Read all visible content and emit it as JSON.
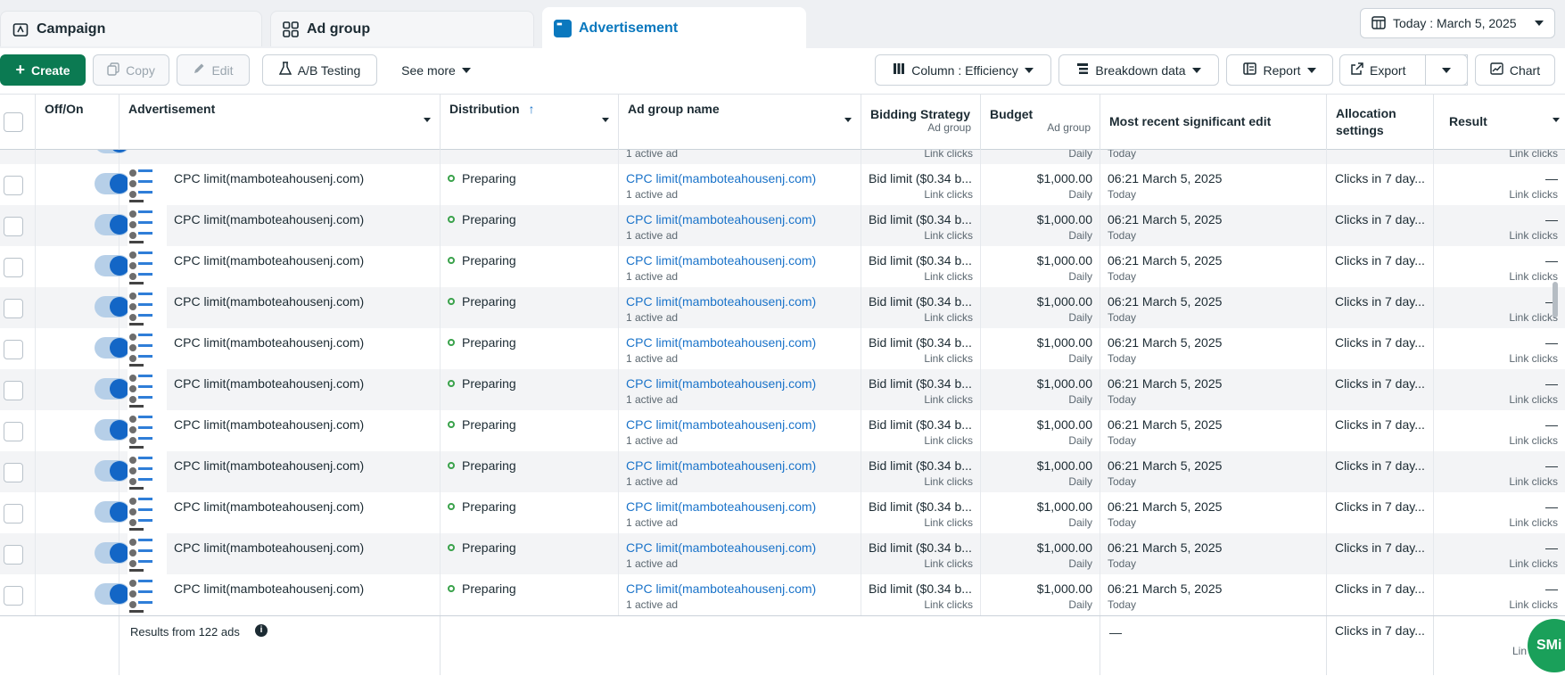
{
  "tabs": [
    {
      "label": "Campaign",
      "icon": "campaign-icon"
    },
    {
      "label": "Ad group",
      "icon": "grid-icon"
    },
    {
      "label": "Advertisement",
      "icon": "ad-icon"
    }
  ],
  "date_filter": {
    "label": "Today : March 5, 2025",
    "icon": "calendar-icon"
  },
  "toolbar": {
    "create": "Create",
    "copy": "Copy",
    "edit": "Edit",
    "ab_testing": "A/B Testing",
    "see_more": "See more",
    "column": "Column : Efficiency",
    "breakdown": "Breakdown data",
    "report": "Report",
    "export": "Export",
    "chart": "Chart"
  },
  "columns": {
    "offon": "Off/On",
    "advertisement": "Advertisement",
    "distribution": "Distribution",
    "ad_group_name": "Ad group name",
    "bidding_strategy": "Bidding Strategy",
    "bidding_strategy_sub": "Ad group",
    "budget": "Budget",
    "budget_sub": "Ad group",
    "recent_edit": "Most recent significant edit",
    "allocation": "Allocation settings",
    "result": "Result"
  },
  "partial_row": {
    "group_sub": "1 active ad",
    "bid_sub": "Link clicks",
    "budget_sub": "Daily",
    "edit_sub": "Today",
    "result_sub": "Link clicks"
  },
  "rows": [
    {
      "name": "CPC limit(mamboteahousenj.com)",
      "status": "Preparing",
      "group": "CPC limit(mamboteahousenj.com)",
      "group_sub": "1 active ad",
      "bid": "Bid limit ($0.34 b...",
      "bid_sub": "Link clicks",
      "budget": "$1,000.00",
      "budget_sub": "Daily",
      "edit": "06:21 March 5, 2025",
      "edit_sub": "Today",
      "allocation": "Clicks in 7 day...",
      "result": "—",
      "result_sub": "Link clicks"
    },
    {
      "name": "CPC limit(mamboteahousenj.com)",
      "status": "Preparing",
      "group": "CPC limit(mamboteahousenj.com)",
      "group_sub": "1 active ad",
      "bid": "Bid limit ($0.34 b...",
      "bid_sub": "Link clicks",
      "budget": "$1,000.00",
      "budget_sub": "Daily",
      "edit": "06:21 March 5, 2025",
      "edit_sub": "Today",
      "allocation": "Clicks in 7 day...",
      "result": "—",
      "result_sub": "Link clicks"
    },
    {
      "name": "CPC limit(mamboteahousenj.com)",
      "status": "Preparing",
      "group": "CPC limit(mamboteahousenj.com)",
      "group_sub": "1 active ad",
      "bid": "Bid limit ($0.34 b...",
      "bid_sub": "Link clicks",
      "budget": "$1,000.00",
      "budget_sub": "Daily",
      "edit": "06:21 March 5, 2025",
      "edit_sub": "Today",
      "allocation": "Clicks in 7 day...",
      "result": "—",
      "result_sub": "Link clicks"
    },
    {
      "name": "CPC limit(mamboteahousenj.com)",
      "status": "Preparing",
      "group": "CPC limit(mamboteahousenj.com)",
      "group_sub": "1 active ad",
      "bid": "Bid limit ($0.34 b...",
      "bid_sub": "Link clicks",
      "budget": "$1,000.00",
      "budget_sub": "Daily",
      "edit": "06:21 March 5, 2025",
      "edit_sub": "Today",
      "allocation": "Clicks in 7 day...",
      "result": "—",
      "result_sub": "Link clicks"
    },
    {
      "name": "CPC limit(mamboteahousenj.com)",
      "status": "Preparing",
      "group": "CPC limit(mamboteahousenj.com)",
      "group_sub": "1 active ad",
      "bid": "Bid limit ($0.34 b...",
      "bid_sub": "Link clicks",
      "budget": "$1,000.00",
      "budget_sub": "Daily",
      "edit": "06:21 March 5, 2025",
      "edit_sub": "Today",
      "allocation": "Clicks in 7 day...",
      "result": "—",
      "result_sub": "Link clicks"
    },
    {
      "name": "CPC limit(mamboteahousenj.com)",
      "status": "Preparing",
      "group": "CPC limit(mamboteahousenj.com)",
      "group_sub": "1 active ad",
      "bid": "Bid limit ($0.34 b...",
      "bid_sub": "Link clicks",
      "budget": "$1,000.00",
      "budget_sub": "Daily",
      "edit": "06:21 March 5, 2025",
      "edit_sub": "Today",
      "allocation": "Clicks in 7 day...",
      "result": "—",
      "result_sub": "Link clicks"
    },
    {
      "name": "CPC limit(mamboteahousenj.com)",
      "status": "Preparing",
      "group": "CPC limit(mamboteahousenj.com)",
      "group_sub": "1 active ad",
      "bid": "Bid limit ($0.34 b...",
      "bid_sub": "Link clicks",
      "budget": "$1,000.00",
      "budget_sub": "Daily",
      "edit": "06:21 March 5, 2025",
      "edit_sub": "Today",
      "allocation": "Clicks in 7 day...",
      "result": "—",
      "result_sub": "Link clicks"
    },
    {
      "name": "CPC limit(mamboteahousenj.com)",
      "status": "Preparing",
      "group": "CPC limit(mamboteahousenj.com)",
      "group_sub": "1 active ad",
      "bid": "Bid limit ($0.34 b...",
      "bid_sub": "Link clicks",
      "budget": "$1,000.00",
      "budget_sub": "Daily",
      "edit": "06:21 March 5, 2025",
      "edit_sub": "Today",
      "allocation": "Clicks in 7 day...",
      "result": "—",
      "result_sub": "Link clicks"
    },
    {
      "name": "CPC limit(mamboteahousenj.com)",
      "status": "Preparing",
      "group": "CPC limit(mamboteahousenj.com)",
      "group_sub": "1 active ad",
      "bid": "Bid limit ($0.34 b...",
      "bid_sub": "Link clicks",
      "budget": "$1,000.00",
      "budget_sub": "Daily",
      "edit": "06:21 March 5, 2025",
      "edit_sub": "Today",
      "allocation": "Clicks in 7 day...",
      "result": "—",
      "result_sub": "Link clicks"
    },
    {
      "name": "CPC limit(mamboteahousenj.com)",
      "status": "Preparing",
      "group": "CPC limit(mamboteahousenj.com)",
      "group_sub": "1 active ad",
      "bid": "Bid limit ($0.34 b...",
      "bid_sub": "Link clicks",
      "budget": "$1,000.00",
      "budget_sub": "Daily",
      "edit": "06:21 March 5, 2025",
      "edit_sub": "Today",
      "allocation": "Clicks in 7 day...",
      "result": "—",
      "result_sub": "Link clicks"
    },
    {
      "name": "CPC limit(mamboteahousenj.com)",
      "status": "Preparing",
      "group": "CPC limit(mamboteahousenj.com)",
      "group_sub": "1 active ad",
      "bid": "Bid limit ($0.34 b...",
      "bid_sub": "Link clicks",
      "budget": "$1,000.00",
      "budget_sub": "Daily",
      "edit": "06:21 March 5, 2025",
      "edit_sub": "Today",
      "allocation": "Clicks in 7 day...",
      "result": "—",
      "result_sub": "Link clicks"
    }
  ],
  "footer": {
    "results": "Results from 122 ads",
    "edit": "—",
    "allocation": "Clicks in 7 day...",
    "result_sub": "Lin"
  },
  "assistant_badge": "SMi",
  "colors": {
    "primary": "#0b7a52",
    "link": "#1a73c9",
    "active_tab": "#0a78be",
    "toggle": "#1366c6",
    "status_dot": "#3aa24b"
  }
}
